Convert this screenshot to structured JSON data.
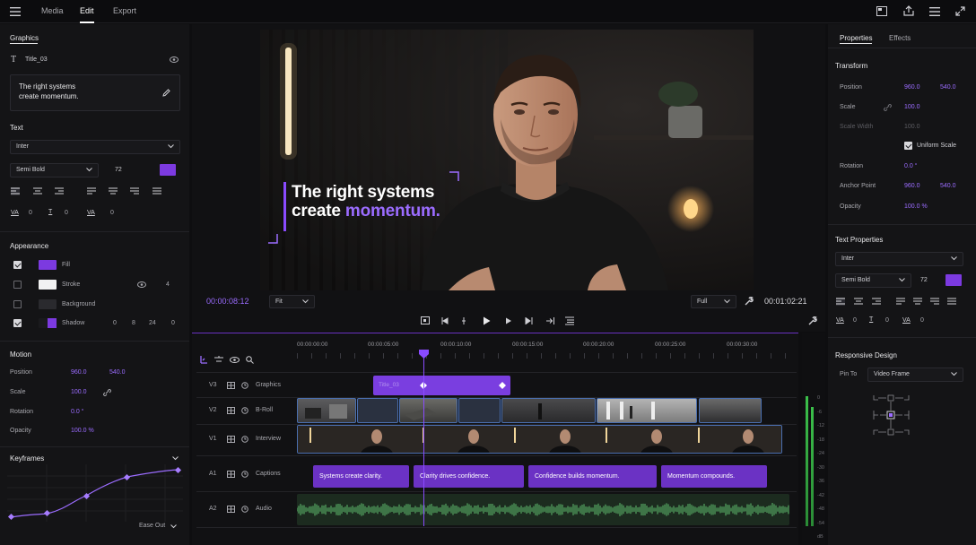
{
  "topbar": {
    "tabs": [
      "Media",
      "Edit",
      "Export"
    ],
    "active_tab": "Edit"
  },
  "left": {
    "graphics_title": "Graphics",
    "layer_name": "Title_03",
    "text_content_line1": "The right systems",
    "text_content_line2": "create momentum.",
    "text_section": "Text",
    "font": "Inter",
    "weight": "Semi Bold",
    "size": "72",
    "tracking_va": "VA",
    "tracking_value": "0",
    "leading_icon": "T",
    "leading_value": "0",
    "kerning_va": "VA",
    "kerning_value": "0",
    "appearance_title": "Appearance",
    "fill_label": "Fill",
    "stroke_label": "Stroke",
    "stroke_value": "4",
    "background_label": "Background",
    "shadow_label": "Shadow",
    "shadow_values": [
      "0",
      "8",
      "24",
      "0"
    ],
    "motion_title": "Motion",
    "position_label": "Position",
    "position_x": "960.0",
    "position_y": "540.0",
    "scale_label": "Scale",
    "scale_value": "100.0",
    "rotation_label": "Rotation",
    "rotation_value": "0.0 °",
    "opacity_label": "Opacity",
    "opacity_value": "100.0 %",
    "keyframes_title": "Keyframes",
    "ease_label": "Ease Out"
  },
  "viewer": {
    "overlay_line1": "The right systems",
    "overlay_line2_a": "create ",
    "overlay_line2_b": "momentum.",
    "timecode": "00:00:08:12",
    "fit": "Fit",
    "quality": "Full",
    "duration": "00:01:02:21"
  },
  "timeline": {
    "ruler": [
      "00:00:00:00",
      "00:00:05:00",
      "00:00:10:00",
      "00:00:15:00",
      "00:00:20:00",
      "00:00:25:00",
      "00:00:30:00"
    ],
    "tracks": [
      {
        "id": "V3",
        "name": "Graphics"
      },
      {
        "id": "V2",
        "name": "B-Roll"
      },
      {
        "id": "V1",
        "name": "Interview"
      },
      {
        "id": "A1",
        "name": "Captions"
      },
      {
        "id": "A2",
        "name": "Audio"
      }
    ],
    "graphics_clip": "Title_03",
    "captions": [
      "Systems create clarity.",
      "Clarity drives confidence.",
      "Confidence builds momentum.",
      "Momentum compounds."
    ],
    "meter_labels": [
      "0",
      "-6",
      "-12",
      "-18",
      "-24",
      "-30",
      "-36",
      "-42",
      "-48",
      "-54",
      "dB"
    ]
  },
  "right": {
    "tabs": [
      "Properties",
      "Effects"
    ],
    "active_tab": "Properties",
    "transform_title": "Transform",
    "position_label": "Position",
    "position_x": "960.0",
    "position_y": "540.0",
    "scale_label": "Scale",
    "scale_value": "100.0",
    "scale_width_label": "Scale Width",
    "scale_width_value": "100.0",
    "uniform_label": "Uniform Scale",
    "rotation_label": "Rotation",
    "rotation_value": "0.0 °",
    "anchor_label": "Anchor Point",
    "anchor_x": "960.0",
    "anchor_y": "540.0",
    "opacity_label": "Opacity",
    "opacity_value": "100.0 %",
    "text_props_title": "Text Properties",
    "font": "Inter",
    "weight": "Semi Bold",
    "size": "72",
    "va1": "VA",
    "va1_value": "0",
    "t_value": "0",
    "va2_value": "0",
    "responsive_title": "Responsive Design",
    "pin_label": "Pin To",
    "pin_value": "Video Frame"
  },
  "colors": {
    "accent": "#7c3ae0",
    "accent_text": "#9b6cff",
    "audio_wave": "#5fbf6f",
    "clip_border": "#4a6fb0"
  }
}
